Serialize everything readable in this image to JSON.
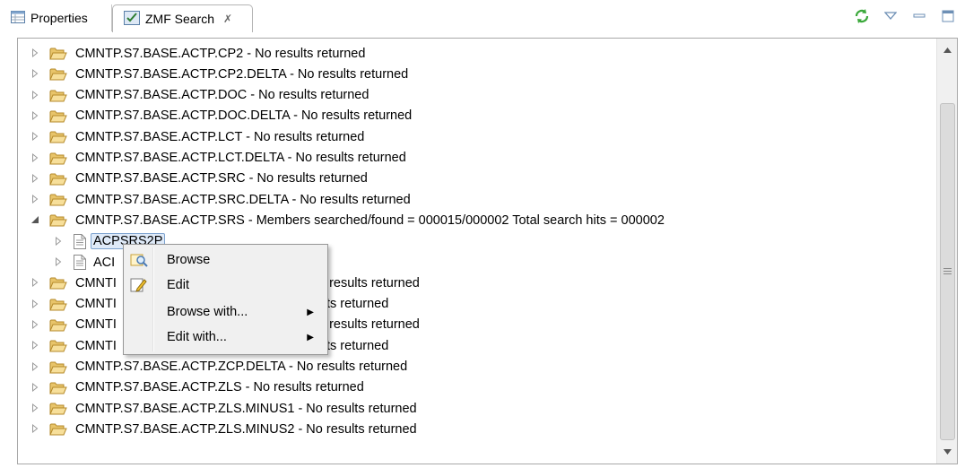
{
  "tabs": [
    {
      "label": "Properties",
      "icon": "properties-icon",
      "active": false
    },
    {
      "label": "ZMF Search",
      "icon": "zmf-search-icon",
      "active": true,
      "close": "✗"
    }
  ],
  "view_toolbar": {
    "icons": [
      "refresh-icon",
      "view-menu-icon",
      "minimize-icon",
      "maximize-icon"
    ]
  },
  "tree": {
    "rows": [
      {
        "label": "CMNTP.S7.BASE.ACTP.CP2 - No results returned",
        "type": "folder",
        "expanded": false
      },
      {
        "label": "CMNTP.S7.BASE.ACTP.CP2.DELTA - No results returned",
        "type": "folder",
        "expanded": false
      },
      {
        "label": "CMNTP.S7.BASE.ACTP.DOC - No results returned",
        "type": "folder",
        "expanded": false
      },
      {
        "label": "CMNTP.S7.BASE.ACTP.DOC.DELTA - No results returned",
        "type": "folder",
        "expanded": false
      },
      {
        "label": "CMNTP.S7.BASE.ACTP.LCT - No results returned",
        "type": "folder",
        "expanded": false
      },
      {
        "label": "CMNTP.S7.BASE.ACTP.LCT.DELTA - No results returned",
        "type": "folder",
        "expanded": false
      },
      {
        "label": "CMNTP.S7.BASE.ACTP.SRC - No results returned",
        "type": "folder",
        "expanded": false
      },
      {
        "label": "CMNTP.S7.BASE.ACTP.SRC.DELTA - No results returned",
        "type": "folder",
        "expanded": false
      },
      {
        "label": "CMNTP.S7.BASE.ACTP.SRS - Members searched/found = 000015/000002 Total search hits = 000002",
        "type": "folder",
        "expanded": true
      },
      {
        "label": "ACPSRS2P",
        "type": "file",
        "expanded": false,
        "selected": true
      },
      {
        "label": "ACI",
        "type": "file",
        "expanded": false
      },
      {
        "label": "CMNTI",
        "suffix": "o results returned",
        "type": "folder",
        "expanded": false
      },
      {
        "label": "CMNTI",
        "suffix": "ts returned",
        "type": "folder",
        "expanded": false
      },
      {
        "label": "CMNTI",
        "suffix": "o results returned",
        "type": "folder",
        "expanded": false
      },
      {
        "label": "CMNTI",
        "suffix": "ts returned",
        "type": "folder",
        "expanded": false
      },
      {
        "label": "CMNTP.S7.BASE.ACTP.ZCP.DELTA - No results returned",
        "type": "folder",
        "expanded": false
      },
      {
        "label": "CMNTP.S7.BASE.ACTP.ZLS - No results returned",
        "type": "folder",
        "expanded": false
      },
      {
        "label": "CMNTP.S7.BASE.ACTP.ZLS.MINUS1 - No results returned",
        "type": "folder",
        "expanded": false
      },
      {
        "label": "CMNTP.S7.BASE.ACTP.ZLS.MINUS2 - No results returned",
        "type": "folder",
        "expanded": false
      }
    ]
  },
  "context_menu": {
    "items": [
      {
        "label": "Browse",
        "icon": "browse-icon",
        "submenu": false
      },
      {
        "label": "Edit",
        "icon": "edit-pencil-icon",
        "submenu": false
      },
      {
        "label": "Browse with...",
        "icon": "",
        "submenu": true
      },
      {
        "label": "Edit with...",
        "icon": "",
        "submenu": true
      }
    ]
  },
  "colors": {
    "folder_fill": "#f6d98a",
    "folder_stroke": "#c79a3a",
    "refresh_green": "#3aa83a",
    "selection": "#dfeaf8"
  }
}
